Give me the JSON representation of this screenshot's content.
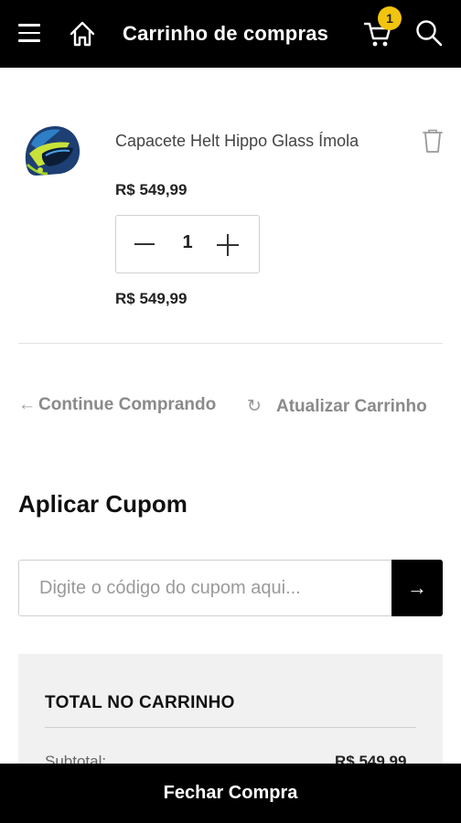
{
  "header": {
    "title": "Carrinho de compras",
    "cart_count": "1",
    "menu_icon": "hamburger-menu-icon",
    "home_icon": "home-icon",
    "cart_icon": "shopping-cart-icon",
    "search_icon": "search-icon"
  },
  "cart": {
    "item": {
      "name": "Capacete Helt Hippo Glass Ímola",
      "unit_price": "R$ 549,99",
      "quantity": "1",
      "line_total": "R$ 549,99",
      "image_icon": "helmet-image",
      "remove_icon": "trash-icon"
    },
    "actions": {
      "continue_label": "Continue Comprando",
      "update_label": "Atualizar Carrinho"
    }
  },
  "coupon": {
    "title": "Aplicar Cupom",
    "placeholder": "Digite o código do cupom aqui...",
    "submit_icon": "arrow-right-icon"
  },
  "totals": {
    "heading": "TOTAL NO CARRINHO",
    "subtotal_label": "Subtotal:",
    "subtotal_value": "R$ 549,99"
  },
  "footer": {
    "checkout_label": "Fechar Compra"
  },
  "colors": {
    "header_bg": "#000000",
    "badge": "#f1c40f",
    "totals_bg": "#f1f1f1"
  }
}
